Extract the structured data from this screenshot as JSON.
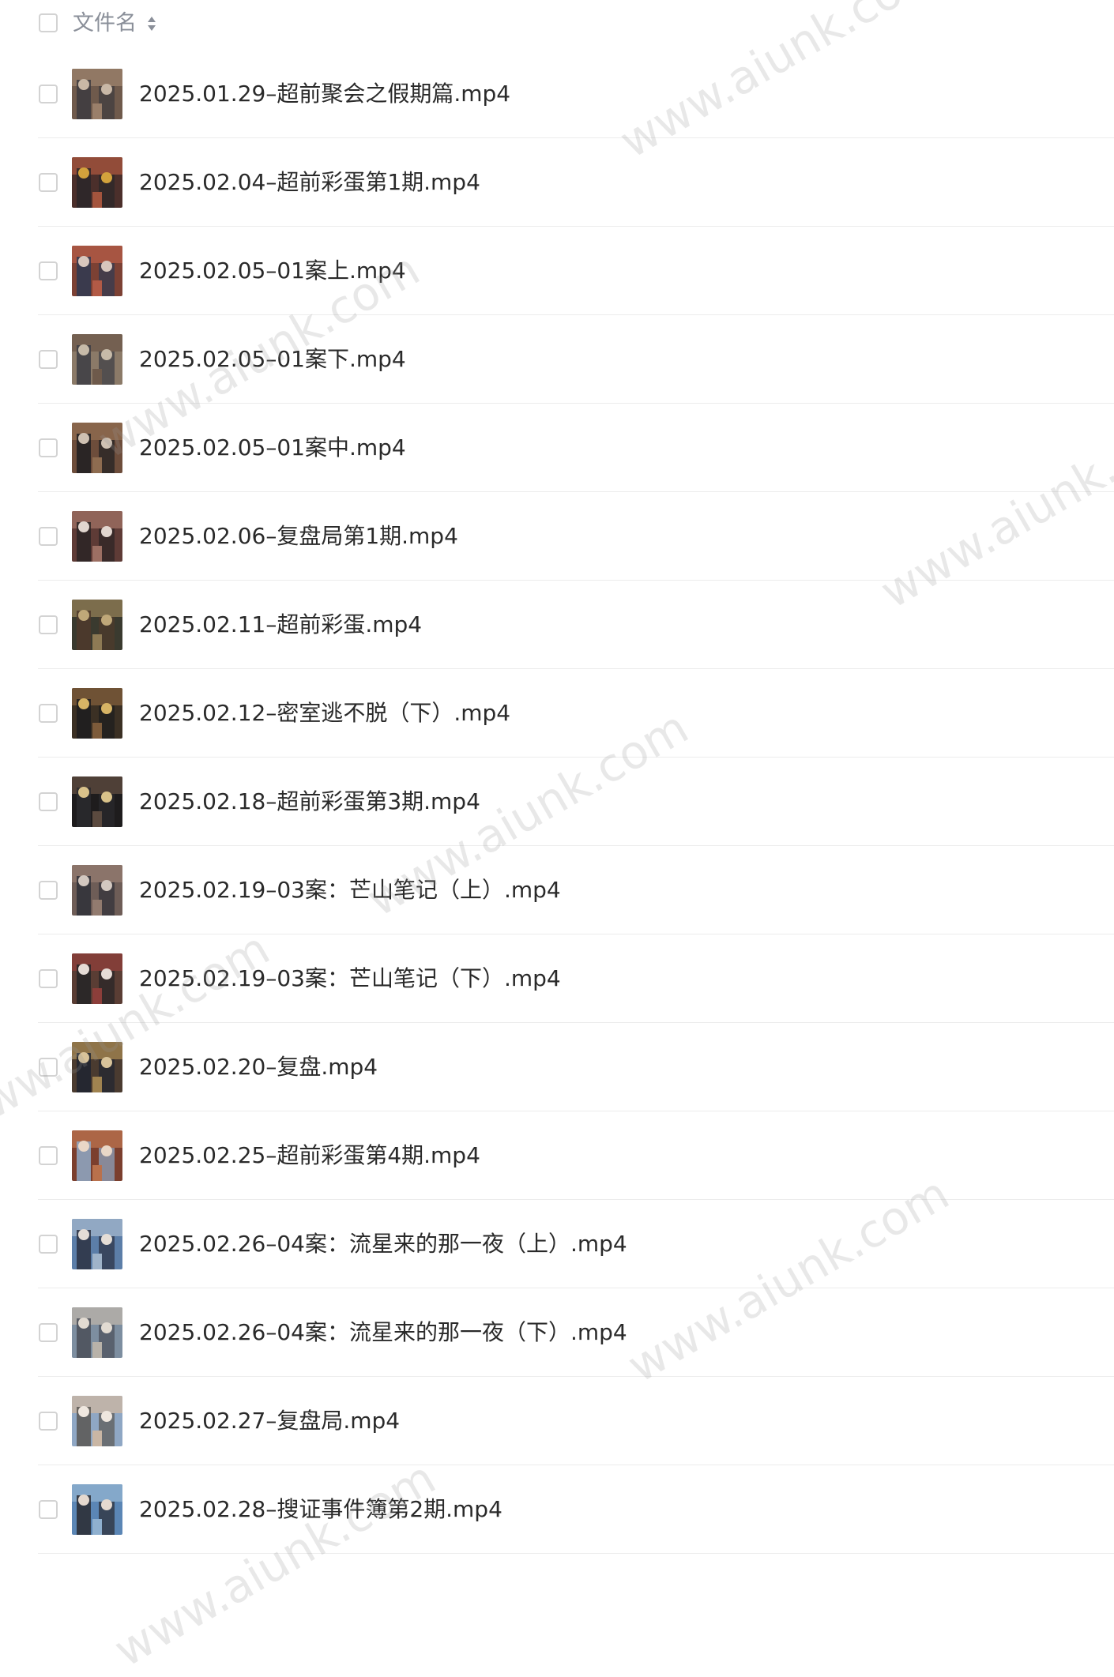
{
  "header": {
    "column_label": "文件名",
    "sort_icon": "sort-updown-icon"
  },
  "files": [
    {
      "name": "2025.01.29–超前聚会之假期篇.mp4",
      "thumb_colors": [
        "#6f5a4c",
        "#c9b8a6",
        "#3d3b3f",
        "#9a7f6a"
      ]
    },
    {
      "name": "2025.02.04–超前彩蛋第1期.mp4",
      "thumb_colors": [
        "#4b2f2b",
        "#d3a23c",
        "#2a2629",
        "#a4543d"
      ]
    },
    {
      "name": "2025.02.05–01案上.mp4",
      "thumb_colors": [
        "#7c4134",
        "#d8c7bd",
        "#2f3a52",
        "#b25a46"
      ]
    },
    {
      "name": "2025.02.05–01案下.mp4",
      "thumb_colors": [
        "#8b7a68",
        "#c7bba9",
        "#3c3d44",
        "#6e5a4b"
      ]
    },
    {
      "name": "2025.02.05–01案中.mp4",
      "thumb_colors": [
        "#6d4d3b",
        "#cfc1b2",
        "#1f1f22",
        "#8e6c50"
      ]
    },
    {
      "name": "2025.02.06–复盘局第1期.mp4",
      "thumb_colors": [
        "#5e3b36",
        "#e2d6cf",
        "#2a2424",
        "#9c6f63"
      ]
    },
    {
      "name": "2025.02.11–超前彩蛋.mp4",
      "thumb_colors": [
        "#3a3a2f",
        "#bfa879",
        "#4f3a2b",
        "#8d7a54"
      ]
    },
    {
      "name": "2025.02.12–密室逃不脱（下）.mp4",
      "thumb_colors": [
        "#3b3024",
        "#d7b465",
        "#1d1c1e",
        "#7d5b3a"
      ]
    },
    {
      "name": "2025.02.18–超前彩蛋第3期.mp4",
      "thumb_colors": [
        "#1e1c1d",
        "#d9c28a",
        "#2a2a2e",
        "#5b4a3f"
      ]
    },
    {
      "name": "2025.02.19–03案：芒山笔记（上）.mp4",
      "thumb_colors": [
        "#6e5d57",
        "#d3c8c0",
        "#2f3038",
        "#927b6f"
      ]
    },
    {
      "name": "2025.02.19–03案：芒山笔记（下）.mp4",
      "thumb_colors": [
        "#5a3d34",
        "#e6dcd6",
        "#252427",
        "#8c3e3a"
      ]
    },
    {
      "name": "2025.02.20–复盘.mp4",
      "thumb_colors": [
        "#4a3b30",
        "#d8c39a",
        "#1f2530",
        "#a08350"
      ]
    },
    {
      "name": "2025.02.25–超前彩蛋第4期.mp4",
      "thumb_colors": [
        "#7b3f2e",
        "#e9d7c7",
        "#8fa9c6",
        "#b9714c"
      ]
    },
    {
      "name": "2025.02.26–04案：流星来的那一夜（上）.mp4",
      "thumb_colors": [
        "#5c7ea8",
        "#e4ddd6",
        "#2b3142",
        "#9fb3c9"
      ]
    },
    {
      "name": "2025.02.26–04案：流星来的那一夜（下）.mp4",
      "thumb_colors": [
        "#7d8ea0",
        "#e2dbd2",
        "#4a4f58",
        "#b8b2a9"
      ]
    },
    {
      "name": "2025.02.27–复盘局.mp4",
      "thumb_colors": [
        "#8fa7c4",
        "#efe7df",
        "#5a5753",
        "#c9b6a4"
      ]
    },
    {
      "name": "2025.02.28–搜证事件簿第2期.mp4",
      "thumb_colors": [
        "#5b86b5",
        "#e5d9cf",
        "#2a2a30",
        "#8fb0cf"
      ]
    }
  ],
  "watermark_text": "www.aiunk.com"
}
